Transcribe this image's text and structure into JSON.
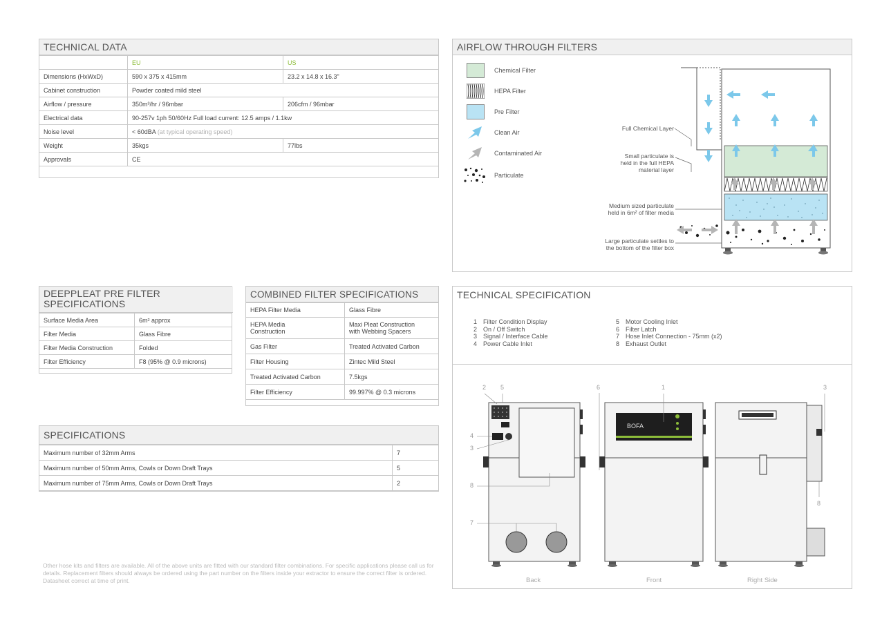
{
  "technical_data": {
    "title": "TECHNICAL DATA",
    "col_eu": "EU",
    "col_us": "US",
    "rows": [
      {
        "label": "Dimensions (HxWxD)",
        "eu": "590 x 375 x 415mm",
        "us": "23.2 x 14.8 x 16.3\""
      },
      {
        "label": "Cabinet construction",
        "both": "Powder coated mild steel"
      },
      {
        "label": "Airflow / pressure",
        "eu": "350m³/hr / 96mbar",
        "us": "206cfm / 96mbar"
      },
      {
        "label": "Electrical data",
        "both": "90-257v 1ph 50/60Hz  Full load current: 12.5 amps / 1.1kw"
      },
      {
        "label": "Noise level",
        "both": "< 60dBA",
        "both_note": "(at typical operating speed)"
      },
      {
        "label": "Weight",
        "eu": "35kgs",
        "us": "77lbs"
      },
      {
        "label": "Approvals",
        "both": "CE"
      }
    ]
  },
  "airflow": {
    "title": "AIRFLOW THROUGH FILTERS",
    "legend": [
      "Chemical Filter",
      "HEPA Filter",
      "Pre Filter",
      "Clean Air",
      "Contaminated Air",
      "Particulate"
    ],
    "callouts": {
      "chemical": "Full Chemical Layer",
      "small_1": "Small particulate is",
      "small_2": "held in the full HEPA",
      "small_3": "material layer",
      "medium_1": "Medium sized particulate",
      "medium_2": "held in 6m² of filter media",
      "large_1": "Large particulate settles to",
      "large_2": "the bottom of the filter box"
    },
    "colors": {
      "chemical": "#d4ead6",
      "pre": "#b9e3f4",
      "clean_arrow": "#7cc8ea",
      "dirty_arrow": "#b5b5b5"
    }
  },
  "deeppleat": {
    "title_1": "DEEPPLEAT PRE FILTER",
    "title_2": "SPECIFICATIONS",
    "rows": [
      {
        "label": "Surface Media Area",
        "value": "6m² approx"
      },
      {
        "label": "Filter Media",
        "value": "Glass Fibre"
      },
      {
        "label": "Filter Media Construction",
        "value": "Folded"
      },
      {
        "label": "Filter Efficiency",
        "value": "F8 (95% @ 0.9 microns)"
      }
    ]
  },
  "combined": {
    "title": "COMBINED FILTER SPECIFICATIONS",
    "rows": [
      {
        "label": "HEPA Filter Media",
        "value": "Glass Fibre"
      },
      {
        "label_1": "HEPA Media",
        "label_2": "Construction",
        "value_1": "Maxi Pleat Construction",
        "value_2": "with Webbing Spacers"
      },
      {
        "label": "Gas Filter",
        "value": "Treated Activated Carbon"
      },
      {
        "label": "Filter Housing",
        "value": "Zintec Mild Steel"
      },
      {
        "label": "Treated Activated Carbon",
        "value": "7.5kgs"
      },
      {
        "label": "Filter Efficiency",
        "value": "99.997% @ 0.3 microns"
      }
    ]
  },
  "specifications": {
    "title": "SPECIFICATIONS",
    "rows": [
      {
        "label": "Maximum number of 32mm Arms",
        "value": "7"
      },
      {
        "label": "Maximum number of 50mm Arms, Cowls or Down Draft Trays",
        "value": "5"
      },
      {
        "label": "Maximum number of 75mm Arms, Cowls or Down Draft Trays",
        "value": "2"
      }
    ]
  },
  "tech_spec": {
    "title": "TECHNICAL SPECIFICATION",
    "left": [
      {
        "n": "1",
        "t": "Filter Condition Display"
      },
      {
        "n": "2",
        "t": "On / Off Switch"
      },
      {
        "n": "3",
        "t": "Signal / Interface Cable"
      },
      {
        "n": "4",
        "t": "Power Cable Inlet"
      }
    ],
    "right": [
      {
        "n": "5",
        "t": "Motor Cooling Inlet"
      },
      {
        "n": "6",
        "t": "Filter Latch"
      },
      {
        "n": "7",
        "t": "Hose Inlet Connection - 75mm (x2)"
      },
      {
        "n": "8",
        "t": "Exhaust Outlet"
      }
    ],
    "numbers": [
      "2",
      "5",
      "6",
      "1",
      "3",
      "4",
      "3",
      "8",
      "7",
      "8"
    ],
    "brand": "BOFA",
    "captions": [
      "Back",
      "Front",
      "Right Side"
    ]
  },
  "footnote": "Other hose kits and filters are available. All of the above units are fitted with our standard filter combinations. For specific applications please call us for details. Replacement filters should always be ordered using the part number on the filters inside your extractor to ensure the correct filter is ordered. Datasheet correct at time of print."
}
